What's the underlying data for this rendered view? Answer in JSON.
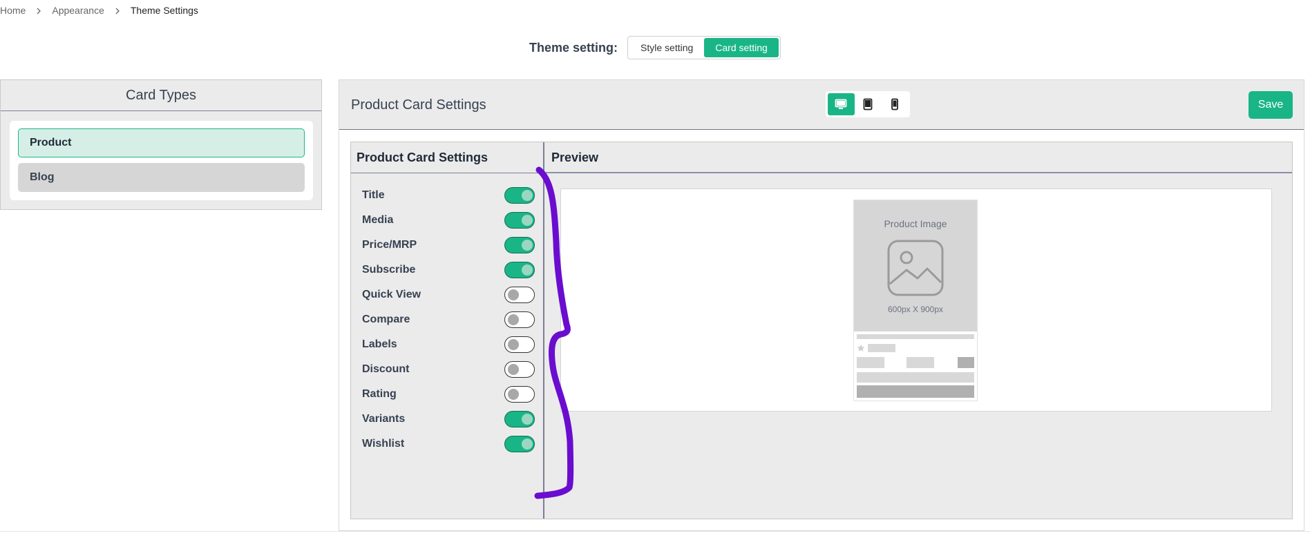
{
  "breadcrumb": {
    "items": [
      "Home",
      "Appearance",
      "Theme Settings"
    ]
  },
  "theme": {
    "label": "Theme setting:",
    "options": [
      "Style setting",
      "Card setting"
    ],
    "selected": "Card setting"
  },
  "card_types": {
    "title": "Card Types",
    "items": [
      {
        "label": "Product",
        "selected": true
      },
      {
        "label": "Blog",
        "selected": false
      }
    ]
  },
  "main": {
    "title": "Product Card Settings",
    "devices": [
      {
        "icon": "desktop-icon",
        "active": true
      },
      {
        "icon": "tablet-icon",
        "active": false
      },
      {
        "icon": "mobile-icon",
        "active": false
      }
    ],
    "save_label": "Save",
    "settings_header": "Product Card Settings",
    "preview_header": "Preview",
    "toggles": [
      {
        "label": "Title",
        "on": true
      },
      {
        "label": "Media",
        "on": true
      },
      {
        "label": "Price/MRP",
        "on": true
      },
      {
        "label": "Subscribe",
        "on": true
      },
      {
        "label": "Quick View",
        "on": false
      },
      {
        "label": "Compare",
        "on": false
      },
      {
        "label": "Labels",
        "on": false
      },
      {
        "label": "Discount",
        "on": false
      },
      {
        "label": "Rating",
        "on": false
      },
      {
        "label": "Variants",
        "on": true
      },
      {
        "label": "Wishlist",
        "on": true
      }
    ],
    "preview": {
      "image_label": "Product Image",
      "image_size": "600px X 900px"
    }
  },
  "colors": {
    "accent": "#1ab587",
    "annotation": "#6a0dcf"
  }
}
